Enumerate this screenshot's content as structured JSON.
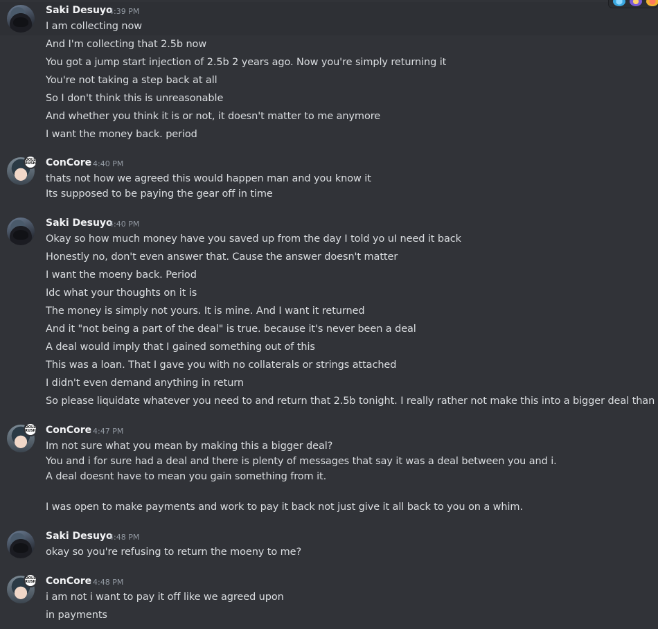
{
  "messages": [
    {
      "author": "Saki Desuyo",
      "time": "4:39 PM",
      "lines": [
        "I am collecting now",
        "And I'm collecting that 2.5b now",
        "You got a jump start injection of 2.5b 2 years ago. Now you're simply returning it",
        "You're not taking a step back at all",
        "So I don't think this is unreasonable",
        "And whether you think it is or not, it doesn't matter to me anymore",
        "I want the money back. period"
      ]
    },
    {
      "author": "ConCore",
      "time": "4:40 PM",
      "badge": [
        "DOLL",
        "RUSH"
      ],
      "lines": [
        "thats not how we agreed this would happen man and you know it",
        "Its supposed to be paying the gear off in time"
      ]
    },
    {
      "author": "Saki Desuyo",
      "time": "4:40 PM",
      "lines": [
        "Okay so how much money have you saved up from the day I told yo uI need it back",
        "Honestly no, don't even answer that. Cause the answer doesn't matter",
        "I want the moeny back. Period",
        "Idc what your thoughts on it is",
        "The money is simply not yours. It is mine. And I want it returned",
        "And it \"not being a part of the deal\"  is true. because it's never been a deal",
        "A deal would imply that I gained something out of this",
        "This was a loan. That I gave you with no collaterals or strings attached",
        "I didn't even demand anything in return",
        "So please liquidate whatever you need to and return that 2.5b tonight. I really rather not make this into a bigger  deal than it is"
      ]
    },
    {
      "author": "ConCore",
      "time": "4:47 PM",
      "badge": [
        "DOLL",
        "RUSH"
      ],
      "lines": [
        "Im not sure what you mean by making this a bigger deal?",
        "You and i for sure had a deal and there is plenty of messages that say it was a deal between you and i.",
        "A deal doesnt have to mean you gain something from it.",
        "I was open to make payments and work to pay it back not just give it all back to you on a whim."
      ]
    },
    {
      "author": "Saki Desuyo",
      "time": "4:48 PM",
      "lines": [
        "okay so you're refusing to return the moeny to me?"
      ]
    },
    {
      "author": "ConCore",
      "time": "4:48 PM",
      "badge": [
        "DOLL",
        "RUSH"
      ],
      "lines": [
        "i am not i want to pay it off like we agreed upon",
        "in payments"
      ]
    }
  ],
  "reactions": [
    "blue-emoji-icon",
    "party-emoji-icon",
    "orange-emoji-icon"
  ]
}
